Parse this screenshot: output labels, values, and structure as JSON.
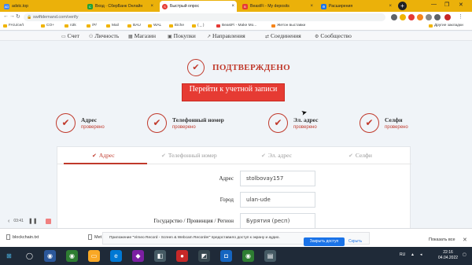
{
  "browser": {
    "tabs": [
      {
        "label": "adstc.top",
        "icon_color": "#4285f4",
        "icon_text": "AD"
      },
      {
        "label": "Вход · СберБанк Онлайн",
        "icon_color": "#21a038",
        "icon_text": "С"
      },
      {
        "label": "Быстрый опрос",
        "icon_color": "#e63b33",
        "icon_text": "S",
        "active": true
      },
      {
        "label": "BeastFi - My deposits",
        "icon_color": "#e53935",
        "icon_text": "B"
      },
      {
        "label": "Расширения",
        "icon_color": "#1a73e8",
        "icon_text": "⚙"
      }
    ],
    "new_tab": "+",
    "url": "swiftdemand.com/verify",
    "bookmarks": [
      "FA/u/ce/t",
      "CO+",
      "n3k",
      "/P/",
      "Mail",
      "BAU",
      "WAL",
      "Eiche",
      "( _ )",
      "BeastFi - Make Mo...",
      "Жетон выставки"
    ],
    "bookmarks_right": "Другие закладки"
  },
  "site": {
    "nav": [
      "Счет",
      "Личность",
      "Магазин",
      "Покупки",
      "Направления",
      "Соединения",
      "Сообщество"
    ],
    "confirmed_text": "ПОДТВЕРЖДЕНО",
    "go_button": "Перейти к учетной записи",
    "steps": [
      {
        "name": "Адрес",
        "status": "проверено"
      },
      {
        "name": "Телефонный номер",
        "status": "проверено"
      },
      {
        "name": "Эл. адрес",
        "status": "проверено"
      },
      {
        "name": "Селфи",
        "status": "проверено"
      }
    ],
    "tabs": [
      "Адрес",
      "Телефонный номер",
      "Эл. адрес",
      "Селфи"
    ],
    "form": [
      {
        "label": "Адрес",
        "value": "stolbovay157"
      },
      {
        "label": "Город",
        "value": "ulan-ude"
      },
      {
        "label": "Государство / Провинция / Регион",
        "value": "Бурятия (респ)"
      }
    ]
  },
  "recorder": {
    "time": "03:41"
  },
  "downloads": {
    "file1": "blockchain.txt",
    "file2": "Met",
    "notice": "Приложение \"Vimeo Record - Screen & Webcam Recorder\" предоставило доступ к экрану и аудио.",
    "allow": "Закрыть доступ",
    "hide": "Скрыть",
    "show_all": "Показать все"
  },
  "taskbar": {
    "lang": "RU",
    "time": "22:16",
    "date": "04.04.2022"
  },
  "colors": {
    "accent": "#c0392b",
    "button": "#e63b33",
    "chrome_tabbar": "#ebb10a"
  }
}
